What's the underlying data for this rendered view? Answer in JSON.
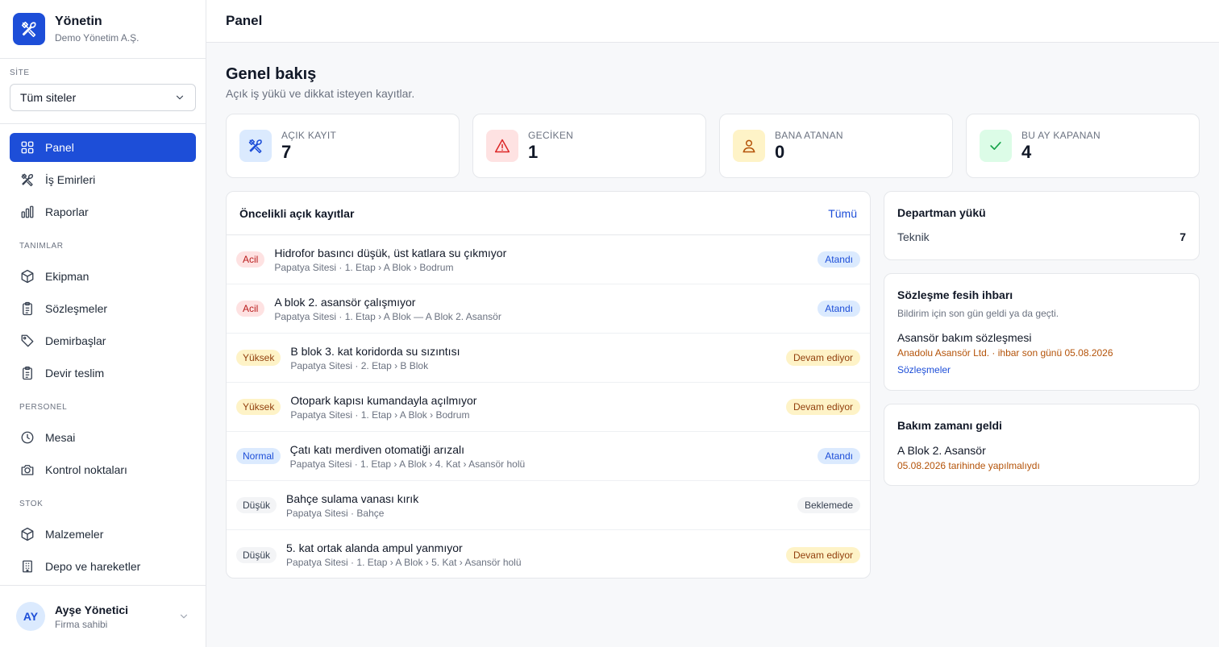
{
  "brand": {
    "name": "Yönetin",
    "company": "Demo Yönetim A.Ş.",
    "logo_icon": "tools-icon",
    "color": "#1d4ed8"
  },
  "site": {
    "label": "SİTE",
    "selected": "Tüm siteler"
  },
  "nav": {
    "main": [
      {
        "label": "Panel",
        "icon": "grid-icon",
        "active": true
      },
      {
        "label": "İş Emirleri",
        "icon": "tools-icon"
      },
      {
        "label": "Raporlar",
        "icon": "bar-chart-icon"
      }
    ],
    "sections": [
      {
        "title": "TANIMLAR",
        "items": [
          {
            "label": "Ekipman",
            "icon": "cube-icon"
          },
          {
            "label": "Sözleşmeler",
            "icon": "clipboard-icon"
          },
          {
            "label": "Demirbaşlar",
            "icon": "tag-icon"
          },
          {
            "label": "Devir teslim",
            "icon": "clipboard-icon"
          }
        ]
      },
      {
        "title": "PERSONEL",
        "items": [
          {
            "label": "Mesai",
            "icon": "clock-icon"
          },
          {
            "label": "Kontrol noktaları",
            "icon": "camera-icon"
          }
        ]
      },
      {
        "title": "STOK",
        "items": [
          {
            "label": "Malzemeler",
            "icon": "cube-icon"
          },
          {
            "label": "Depo ve hareketler",
            "icon": "building-icon"
          }
        ]
      }
    ]
  },
  "user": {
    "initials": "AY",
    "name": "Ayşe Yönetici",
    "role": "Firma sahibi"
  },
  "topbar": {
    "title": "Panel"
  },
  "page": {
    "title": "Genel bakış",
    "subtitle": "Açık iş yükü ve dikkat isteyen kayıtlar."
  },
  "stats": [
    {
      "label": "AÇIK KAYIT",
      "value": "7",
      "icon": "tools-icon",
      "bg": "#dbeafe",
      "fg": "#1d4ed8"
    },
    {
      "label": "GECİKEN",
      "value": "1",
      "icon": "warning-icon",
      "bg": "#fee2e2",
      "fg": "#dc2626"
    },
    {
      "label": "BANA ATANAN",
      "value": "0",
      "icon": "user-icon",
      "bg": "#fef3c7",
      "fg": "#b45309"
    },
    {
      "label": "BU AY KAPANAN",
      "value": "4",
      "icon": "check-icon",
      "bg": "#dcfce7",
      "fg": "#16a34a"
    }
  ],
  "priority_list": {
    "title": "Öncelikli açık kayıtlar",
    "link": "Tümü",
    "rows": [
      {
        "priority": "Acil",
        "prio_class": "acil",
        "title": "Hidrofor basıncı düşük, üst katlara su çıkmıyor",
        "location": "Papatya Sitesi · 1. Etap › A Blok › Bodrum",
        "status": "Atandı",
        "status_class": "atandi"
      },
      {
        "priority": "Acil",
        "prio_class": "acil",
        "title": "A blok 2. asansör çalışmıyor",
        "location": "Papatya Sitesi · 1. Etap › A Blok — A Blok 2. Asansör",
        "status": "Atandı",
        "status_class": "atandi"
      },
      {
        "priority": "Yüksek",
        "prio_class": "yuksek",
        "title": "B blok 3. kat koridorda su sızıntısı",
        "location": "Papatya Sitesi · 2. Etap › B Blok",
        "status": "Devam ediyor",
        "status_class": "devam"
      },
      {
        "priority": "Yüksek",
        "prio_class": "yuksek",
        "title": "Otopark kapısı kumandayla açılmıyor",
        "location": "Papatya Sitesi · 1. Etap › A Blok › Bodrum",
        "status": "Devam ediyor",
        "status_class": "devam"
      },
      {
        "priority": "Normal",
        "prio_class": "normal",
        "title": "Çatı katı merdiven otomatiği arızalı",
        "location": "Papatya Sitesi · 1. Etap › A Blok › 4. Kat › Asansör holü",
        "status": "Atandı",
        "status_class": "atandi"
      },
      {
        "priority": "Düşük",
        "prio_class": "dusuk",
        "title": "Bahçe sulama vanası kırık",
        "location": "Papatya Sitesi · Bahçe",
        "status": "Beklemede",
        "status_class": "bekle"
      },
      {
        "priority": "Düşük",
        "prio_class": "dusuk",
        "title": "5. kat ortak alanda ampul yanmıyor",
        "location": "Papatya Sitesi · 1. Etap › A Blok › 5. Kat › Asansör holü",
        "status": "Devam ediyor",
        "status_class": "devam"
      }
    ]
  },
  "department": {
    "title": "Departman yükü",
    "name": "Teknik",
    "count": "7"
  },
  "contract_notice": {
    "title": "Sözleşme fesih ihbarı",
    "subtitle": "Bildirim için son gün geldi ya da geçti.",
    "item_title": "Asansör bakım sözleşmesi",
    "item_detail": "Anadolu Asansör Ltd. · ihbar son günü 05.08.2026",
    "link": "Sözleşmeler"
  },
  "maintenance": {
    "title": "Bakım zamanı geldi",
    "item_title": "A Blok 2. Asansör",
    "item_detail": "05.08.2026 tarihinde yapılmalıydı"
  }
}
